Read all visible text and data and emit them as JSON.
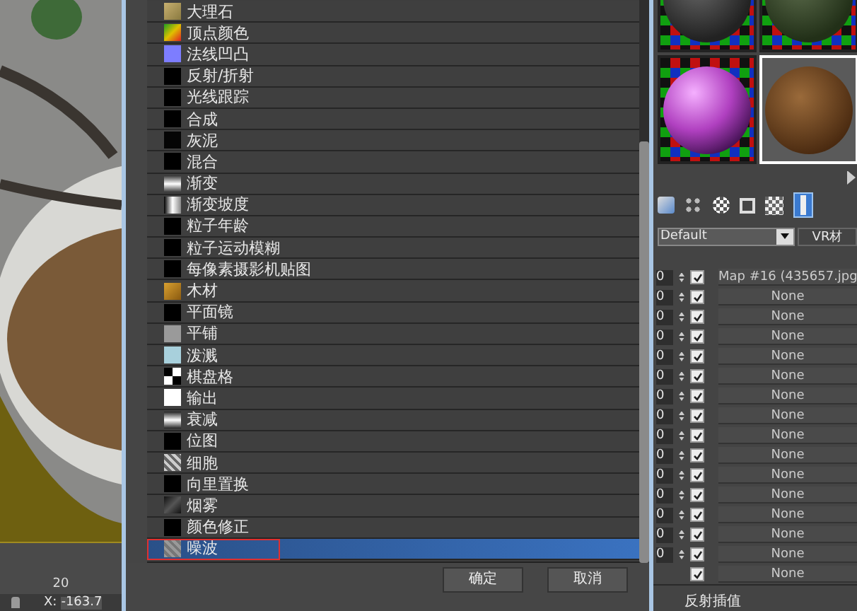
{
  "viewport": {
    "timeline_tick": "20",
    "coord_label": "X:",
    "coord_value": "-163.7"
  },
  "map_browser": {
    "items": [
      {
        "label": "大理石",
        "selected": false
      },
      {
        "label": "顶点颜色",
        "selected": false
      },
      {
        "label": "法线凹凸",
        "selected": false
      },
      {
        "label": "反射/折射",
        "selected": false
      },
      {
        "label": "光线跟踪",
        "selected": false
      },
      {
        "label": "合成",
        "selected": false
      },
      {
        "label": "灰泥",
        "selected": false
      },
      {
        "label": "混合",
        "selected": false
      },
      {
        "label": "渐变",
        "selected": false
      },
      {
        "label": "渐变坡度",
        "selected": false
      },
      {
        "label": "粒子年龄",
        "selected": false
      },
      {
        "label": "粒子运动模糊",
        "selected": false
      },
      {
        "label": "每像素摄影机贴图",
        "selected": false
      },
      {
        "label": "木材",
        "selected": false
      },
      {
        "label": "平面镜",
        "selected": false
      },
      {
        "label": "平铺",
        "selected": false
      },
      {
        "label": "泼溅",
        "selected": false
      },
      {
        "label": "棋盘格",
        "selected": false
      },
      {
        "label": "输出",
        "selected": false
      },
      {
        "label": "衰减",
        "selected": false
      },
      {
        "label": "位图",
        "selected": false
      },
      {
        "label": "细胞",
        "selected": false
      },
      {
        "label": "向里置换",
        "selected": false
      },
      {
        "label": "烟雾",
        "selected": false
      },
      {
        "label": "颜色修正",
        "selected": false
      },
      {
        "label": "噪波",
        "selected": true
      }
    ],
    "buttons": [
      "确定",
      "取消"
    ]
  },
  "material_editor": {
    "slots": [
      {
        "selected": false
      },
      {
        "selected": false
      },
      {
        "selected": false
      },
      {
        "selected": true
      }
    ],
    "dropdown": "Default",
    "type_label": "VR材",
    "maps": [
      {
        "amount": "0",
        "enabled": true,
        "map": "Map #16 (435657.jpg"
      },
      {
        "amount": "0",
        "enabled": true,
        "map": "None"
      },
      {
        "amount": "0",
        "enabled": true,
        "map": "None"
      },
      {
        "amount": "0",
        "enabled": true,
        "map": "None"
      },
      {
        "amount": "0",
        "enabled": true,
        "map": "None"
      },
      {
        "amount": "0",
        "enabled": true,
        "map": "None"
      },
      {
        "amount": "0",
        "enabled": true,
        "map": "None"
      },
      {
        "amount": "0",
        "enabled": true,
        "map": "None"
      },
      {
        "amount": "0",
        "enabled": true,
        "map": "None"
      },
      {
        "amount": "0",
        "enabled": true,
        "map": "None"
      },
      {
        "amount": "0",
        "enabled": true,
        "map": "None"
      },
      {
        "amount": "0",
        "enabled": true,
        "map": "None"
      },
      {
        "amount": "0",
        "enabled": true,
        "map": "None"
      },
      {
        "amount": "0",
        "enabled": true,
        "map": "None"
      },
      {
        "amount": "0",
        "enabled": true,
        "map": "None"
      },
      {
        "enabled": true,
        "map": "None"
      }
    ],
    "footer": "反射插值"
  }
}
